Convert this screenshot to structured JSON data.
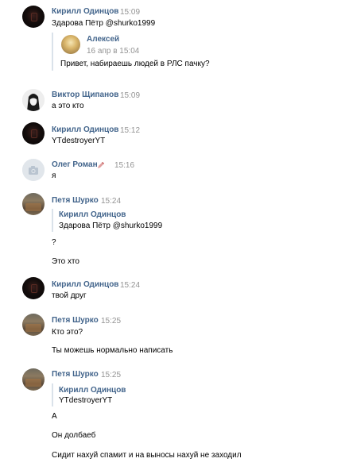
{
  "messages": [
    {
      "author": "Кирилл Одинцов",
      "time": "15:09",
      "avatar": "dark-avatar",
      "lines": [
        "Здарова Пётр @shurko1999"
      ],
      "quote": {
        "author": "Алексей",
        "date": "16 апр в 15:04",
        "text": "Привет, набираешь людей в РЛС пачку?"
      }
    },
    {
      "author": "Виктор Щипанов",
      "time": "15:09",
      "avatar": "anime-avatar",
      "lines": [
        "а это кто"
      ]
    },
    {
      "author": "Кирилл Одинцов",
      "time": "15:12",
      "avatar": "dark-avatar",
      "lines": [
        "YTdestroyerYT"
      ]
    },
    {
      "author": "Олег Роман",
      "time": "15:16",
      "avatar": "camera-placeholder-avatar",
      "lines": [
        "я"
      ]
    },
    {
      "author": "Петя Шурко",
      "time": "15:24",
      "avatar": "photo-avatar",
      "quote": {
        "author": "Кирилл Одинцов",
        "text": "Здарова Пётр @shurko1999"
      },
      "lines": [
        "?",
        "Это хто"
      ]
    },
    {
      "author": "Кирилл Одинцов",
      "time": "15:24",
      "avatar": "dark-avatar",
      "lines": [
        "твой друг"
      ]
    },
    {
      "author": "Петя Шурко",
      "time": "15:25",
      "avatar": "photo-avatar",
      "lines": [
        "Кто это?",
        "Ты можешь нормально написать"
      ]
    },
    {
      "author": "Петя Шурко",
      "time": "15:25",
      "avatar": "photo-avatar",
      "quote": {
        "author": "Кирилл Одинцов",
        "text": "YTdestroyerYT"
      },
      "lines": [
        "А",
        "Он долбаеб",
        "Сидит нахуй спамит и на выносы нахуй не заходил"
      ]
    }
  ],
  "colors": {
    "author": "#42648b",
    "time": "#939393",
    "text": "#000000",
    "quote_bar": "#dae2ea"
  }
}
